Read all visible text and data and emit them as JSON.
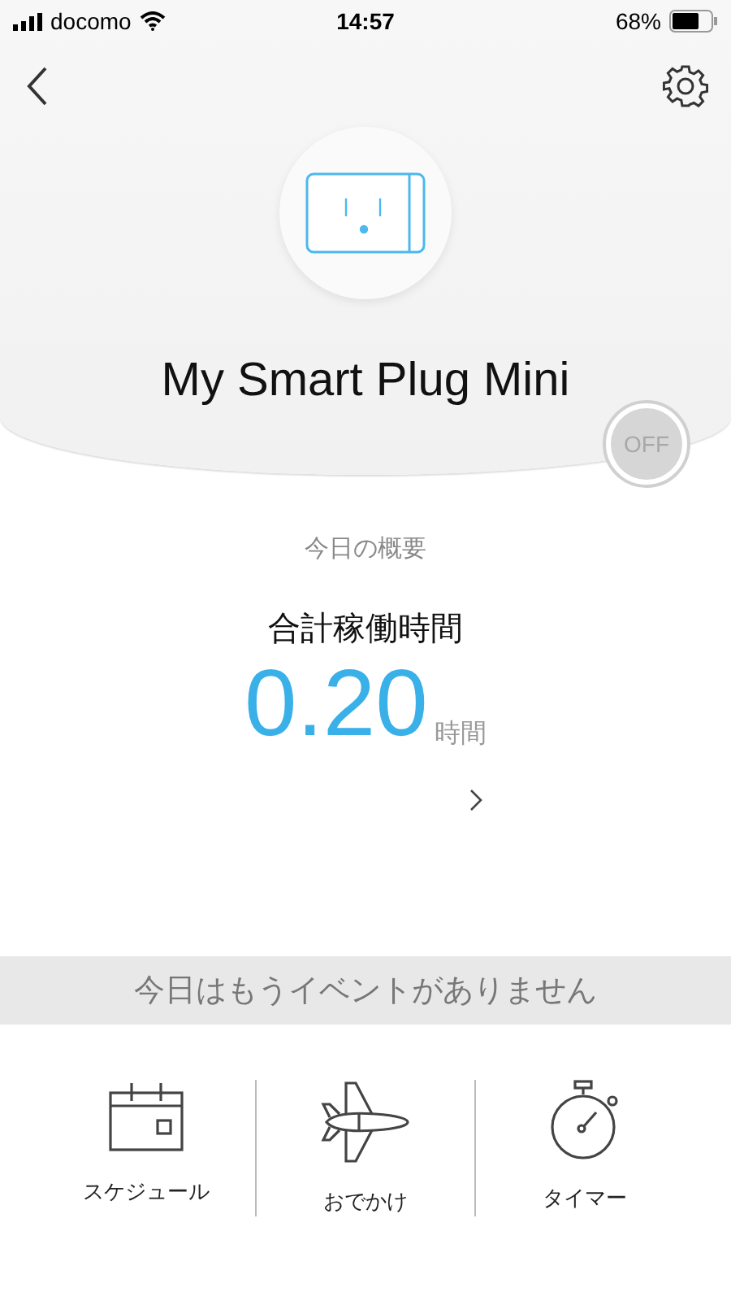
{
  "status_bar": {
    "carrier": "docomo",
    "time": "14:57",
    "battery": "68%"
  },
  "device": {
    "name": "My Smart Plug Mini",
    "power": {
      "label": "OFF",
      "on": false
    }
  },
  "summary": {
    "title": "今日の概要",
    "metric_label": "合計稼働時間",
    "value": "0.20",
    "unit": "時間"
  },
  "events_banner": "今日はもうイベントがありません",
  "actions": [
    {
      "kind": "schedule",
      "label": "スケジュール"
    },
    {
      "kind": "away",
      "label": "おでかけ"
    },
    {
      "kind": "timer",
      "label": "タイマー"
    }
  ]
}
